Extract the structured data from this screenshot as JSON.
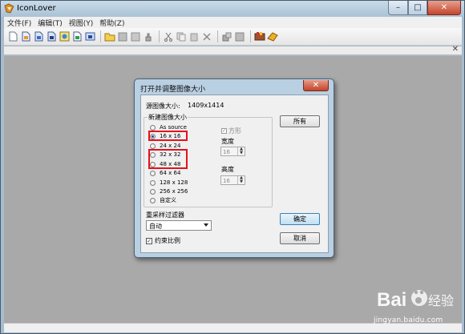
{
  "window": {
    "title": "IconLover",
    "controls": {
      "minimize": "–",
      "maximize": "□",
      "close": "✕"
    }
  },
  "menu": [
    "文件(F)",
    "编辑(T)",
    "视图(Y)",
    "帮助(Z)"
  ],
  "toolbar_icons": [
    "new-icon",
    "open-image-icon",
    "save-icon",
    "save-as-icon",
    "export-icon",
    "library-icon",
    "import-icon",
    "open-folder-icon",
    "grid-icon",
    "frame-icon",
    "stamp-icon",
    "cut-icon",
    "copy-icon",
    "paste-icon",
    "delete-icon",
    "resize-icon",
    "properties-icon",
    "palette-icon",
    "paint-icon"
  ],
  "doc_close": "✕",
  "dialog": {
    "title": "打开并调整图像大小",
    "close": "✕",
    "source_label": "源图像大小:",
    "source_value": "1409x1414",
    "group_title": "新建图像大小",
    "sizes": [
      {
        "label": "As source",
        "checked": false
      },
      {
        "label": "16 x 16",
        "checked": true
      },
      {
        "label": "24 x 24",
        "checked": false
      },
      {
        "label": "32 x 32",
        "checked": false
      },
      {
        "label": "48 x 48",
        "checked": false
      },
      {
        "label": "64 x 64",
        "checked": false
      },
      {
        "label": "128 x 128",
        "checked": false
      },
      {
        "label": "256 x 256",
        "checked": false
      },
      {
        "label": "自定义",
        "checked": false
      }
    ],
    "square_label": "方形",
    "square_checked": true,
    "width_label": "宽度",
    "width_value": "16",
    "height_label": "高度",
    "height_value": "16",
    "all_button": "所有",
    "ok_button": "确定",
    "cancel_button": "取消",
    "filter_label": "重采样过滤器",
    "filter_value": "自动",
    "keep_ratio_label": "约束比例",
    "keep_ratio_checked": true
  },
  "watermark": {
    "brand": "Bai du 经验",
    "site": "jingyan.baidu.com"
  },
  "colors": {
    "highlight": "#e8101c",
    "workspace": "#a9a9a9",
    "dialog_frame": "#b9cfe2"
  }
}
